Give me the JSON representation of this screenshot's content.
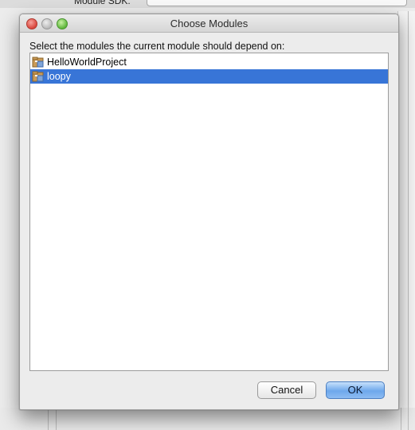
{
  "background": {
    "sdk_label": "Module SDK:"
  },
  "dialog": {
    "title": "Choose Modules",
    "prompt": "Select the modules the current module should depend on:",
    "modules": [
      {
        "label": "HelloWorldProject",
        "selected": false,
        "icon": "module-folder-icon"
      },
      {
        "label": "loopy",
        "selected": true,
        "icon": "module-folder-icon"
      }
    ],
    "buttons": {
      "cancel": "Cancel",
      "ok": "OK"
    }
  },
  "colors": {
    "selection": "#3875d7",
    "ok_button": "#6ea8ec",
    "close_light": "#d9453b",
    "min_light": "#b9b9b9",
    "max_light": "#5eb63b"
  }
}
